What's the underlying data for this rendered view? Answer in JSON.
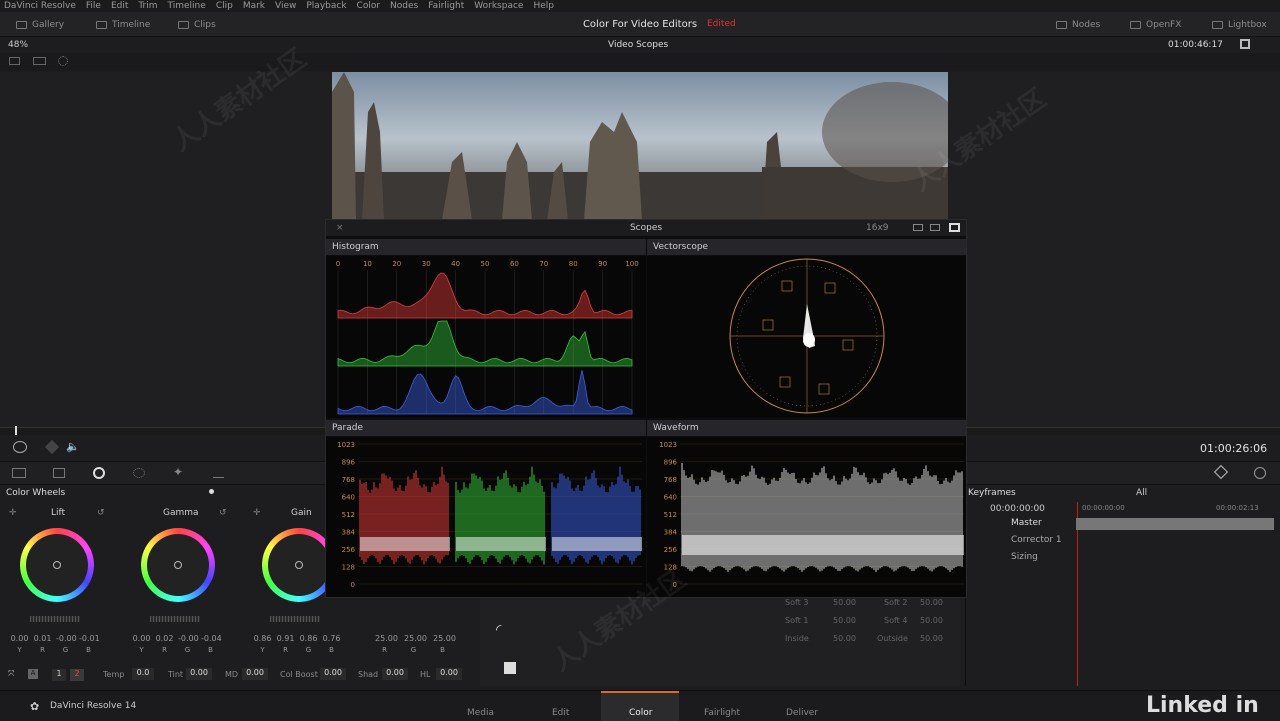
{
  "menu": [
    "DaVinci Resolve",
    "File",
    "Edit",
    "Trim",
    "Timeline",
    "Clip",
    "Mark",
    "View",
    "Playback",
    "Color",
    "Nodes",
    "Fairlight",
    "Workspace",
    "Help"
  ],
  "toolbar": {
    "gallery": "Gallery",
    "timeline": "Timeline",
    "clips": "Clips",
    "project_title": "Color For Video Editors",
    "project_status": "Edited",
    "nodes": "Nodes",
    "openfx": "OpenFX",
    "lightbox": "Lightbox"
  },
  "viewer": {
    "zoom": "48%",
    "scope_select": "Video Scopes",
    "timecode": "01:00:46:17",
    "current_tc": "01:00:26:06"
  },
  "scopes": {
    "title": "Scopes",
    "ratio": "16x9",
    "histogram": "Histogram",
    "vectorscope": "Vectorscope",
    "parade": "Parade",
    "waveform": "Waveform",
    "hist_ticks": [
      "0",
      "10",
      "20",
      "30",
      "40",
      "50",
      "60",
      "70",
      "80",
      "90",
      "100"
    ],
    "wave_ticks": [
      "1023",
      "896",
      "768",
      "640",
      "512",
      "384",
      "256",
      "128",
      "0"
    ],
    "colors": {
      "red": "#e23b3b",
      "green": "#34c23a",
      "blue": "#3b5fe2",
      "grid": "#c98b3a"
    }
  },
  "color_wheels": {
    "title": "Color Wheels",
    "wheels": [
      {
        "label": "Lift",
        "values": [
          "0.00",
          "0.01",
          "-0.00",
          "-0.01"
        ]
      },
      {
        "label": "Gamma",
        "values": [
          "0.00",
          "0.02",
          "-0.00",
          "-0.04"
        ]
      },
      {
        "label": "Gain",
        "values": [
          "0.86",
          "0.91",
          "0.86",
          "0.76"
        ]
      },
      {
        "label": "",
        "values": [
          "25.00",
          "25.00",
          "25.00"
        ]
      }
    ],
    "channels": [
      "Y",
      "R",
      "G",
      "B"
    ],
    "adjust": [
      {
        "label": "Temp",
        "value": "0.0"
      },
      {
        "label": "Tint",
        "value": "0.00"
      },
      {
        "label": "MD",
        "value": "0.00"
      },
      {
        "label": "Col Boost",
        "value": "0.00"
      },
      {
        "label": "Shad",
        "value": "0.00"
      },
      {
        "label": "HL",
        "value": "0.00"
      }
    ],
    "page_numbers": [
      "1",
      "2"
    ]
  },
  "keyframes": {
    "title": "Keyframes",
    "filter": "All",
    "tc_start": "00:00:00:00",
    "tc_ruler_start": "00:00:00:00",
    "tc_ruler_end": "00:00:02:13",
    "tracks": [
      "Master",
      "Corrector 1",
      "Sizing"
    ]
  },
  "mid_panel": {
    "soft1": "Soft 1",
    "soft2": "Soft 2",
    "soft3": "Soft 3",
    "soft4": "Soft 4",
    "inside": "Inside",
    "outside": "Outside",
    "v1": "50.00",
    "v2": "50.00",
    "v3": "50.00",
    "v4": "50.00",
    "v5": "50.00",
    "v6": "50.00"
  },
  "pages": [
    "Media",
    "Edit",
    "Color",
    "Fairlight",
    "Deliver"
  ],
  "app_name": "DaVinci Resolve 14",
  "watermark_text": "人人素材社区",
  "brand": "Linked in"
}
